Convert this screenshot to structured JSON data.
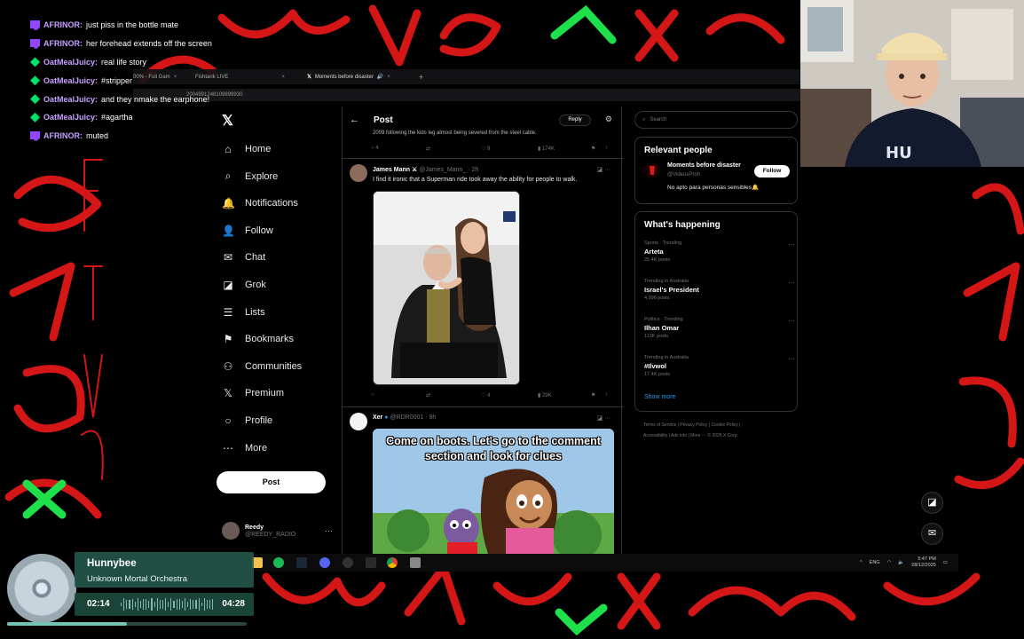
{
  "chat": [
    {
      "badge": "twitch",
      "user": "AFRINOR:",
      "message": "just piss in the bottle mate"
    },
    {
      "badge": "twitch",
      "user": "AFRINOR:",
      "message": "her forehead extends off the screen"
    },
    {
      "badge": "gem",
      "user": "OatMealJuicy:",
      "message": "real life story"
    },
    {
      "badge": "gem",
      "user": "OatMealJuicy:",
      "message": "#stripper"
    },
    {
      "badge": "gem",
      "user": "OatMealJuicy:",
      "message": "and they nmake the earphone!"
    },
    {
      "badge": "gem",
      "user": "OatMealJuicy:",
      "message": "#agartha"
    },
    {
      "badge": "twitch",
      "user": "AFRINOR:",
      "message": "muted"
    }
  ],
  "browser": {
    "tabs": [
      {
        "label": "00% - Full Gam"
      },
      {
        "label": "Fishtank LIVE"
      },
      {
        "label": "Moments before disaster"
      }
    ],
    "url": "2004991248109899930"
  },
  "nav": {
    "items": [
      {
        "label": "Home",
        "icon": "home-icon",
        "glyph": "⌂"
      },
      {
        "label": "Explore",
        "icon": "search-icon",
        "glyph": "⌕"
      },
      {
        "label": "Notifications",
        "icon": "bell-icon",
        "glyph": "🔔"
      },
      {
        "label": "Follow",
        "icon": "add-person-icon",
        "glyph": "👤"
      },
      {
        "label": "Chat",
        "icon": "mail-icon",
        "glyph": "✉"
      },
      {
        "label": "Grok",
        "icon": "grok-icon",
        "glyph": "◪"
      },
      {
        "label": "Lists",
        "icon": "list-icon",
        "glyph": "☰"
      },
      {
        "label": "Bookmarks",
        "icon": "bookmark-icon",
        "glyph": "⚑"
      },
      {
        "label": "Communities",
        "icon": "communities-icon",
        "glyph": "⚇"
      },
      {
        "label": "Premium",
        "icon": "x-icon",
        "glyph": "𝕏"
      },
      {
        "label": "Profile",
        "icon": "person-icon",
        "glyph": "○"
      },
      {
        "label": "More",
        "icon": "more-icon",
        "glyph": "⋯"
      }
    ],
    "post_label": "Post",
    "profile_name": "Reedy",
    "profile_handle": "@REEDY_RADIO"
  },
  "post_header": {
    "title": "Post",
    "reply_label": "Reply"
  },
  "prev_tweet": {
    "text": "2009 following the kids leg almost being severed from the steel cable.",
    "replies": "4",
    "likes": "9",
    "views": "174K"
  },
  "tweet1": {
    "name": "James Mann",
    "handle": "@James_Mann_ · 2h",
    "text": "I find it ironic that a Superman ride took away the ability for people to walk.",
    "likes": "4",
    "views": "29K"
  },
  "tweet2": {
    "name": "Xer",
    "handle": "@RDR0001 · 9h",
    "meme_text": "Come on boots. Let's go to the comment section and look for clues"
  },
  "right": {
    "search_placeholder": "Search",
    "relevant_title": "Relevant people",
    "relevant_name": "Moments before disaster",
    "relevant_handle": "@VideosProh",
    "relevant_bio": "No apto para personas sensibles🔔",
    "follow_label": "Follow",
    "happening_title": "What's happening",
    "trends": [
      {
        "category": "Sports · Trending",
        "name": "Arteta",
        "posts": "25.4K posts"
      },
      {
        "category": "Trending in Australia",
        "name": "Israel's President",
        "posts": "4,996 posts"
      },
      {
        "category": "Politics · Trending",
        "name": "Ilhan Omar",
        "posts": "113K posts"
      },
      {
        "category": "Trending in Australia",
        "name": "#Ilvwol",
        "posts": "17.4K posts"
      }
    ],
    "show_more": "Show more",
    "footer_line1": "Terms of Service  |  Privacy Policy  |  Cookie Policy  |",
    "footer_line2": "Accessibility  |  Ads info  |  More ···  © 2025 X Corp."
  },
  "taskbar": {
    "lang": "ENG",
    "time": "5:47 PM",
    "date": "28/12/2025"
  },
  "spotify": {
    "title": "Hunnybee",
    "artist": "Unknown Mortal Orchestra",
    "elapsed": "02:14",
    "duration": "04:28",
    "progress": 0.5
  },
  "colors": {
    "accent": "#1d9bf0",
    "background": "#000000",
    "scribble_red": "#e01818",
    "scribble_green": "#1ee04a"
  }
}
